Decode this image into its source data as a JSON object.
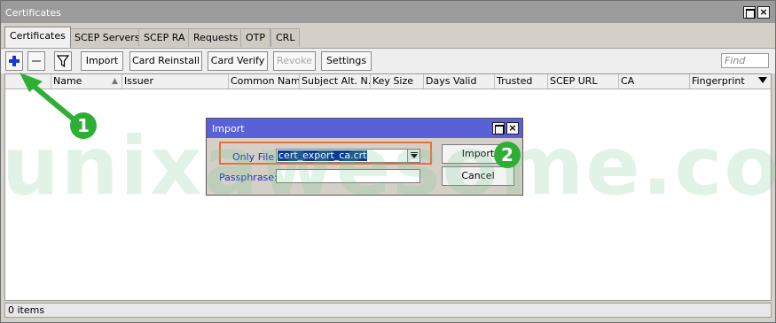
{
  "window": {
    "title": "Certificates"
  },
  "tabs": [
    {
      "label": "Certificates",
      "active": true
    },
    {
      "label": "SCEP Servers"
    },
    {
      "label": "SCEP RA"
    },
    {
      "label": "Requests"
    },
    {
      "label": "OTP"
    },
    {
      "label": "CRL"
    }
  ],
  "toolbar": {
    "add_icon": "plus-icon",
    "remove_icon": "minus-icon",
    "filter_icon": "filter-icon",
    "import_label": "Import",
    "card_reinstall_label": "Card Reinstall",
    "card_verify_label": "Card Verify",
    "revoke_label": "Revoke",
    "settings_label": "Settings",
    "find_placeholder": "Find"
  },
  "table": {
    "columns": [
      "Name",
      "Issuer",
      "Common Name",
      "Subject Alt. N...",
      "Key Size",
      "Days Valid",
      "Trusted",
      "SCEP URL",
      "CA",
      "Fingerprint"
    ],
    "rows": []
  },
  "status": {
    "items_text": "0 items"
  },
  "dialog": {
    "title": "Import",
    "only_file_label": "Only File",
    "only_file_value": "cert_export_ca.crt",
    "passphrase_label": "Passphrase:",
    "passphrase_value": "",
    "import_label": "Import",
    "cancel_label": "Cancel"
  },
  "annotations": {
    "badge_1": "1",
    "badge_2": "2",
    "color_badge": "#2fae36",
    "color_highlight": "#e8703a"
  },
  "watermark": "unixawesome.com"
}
